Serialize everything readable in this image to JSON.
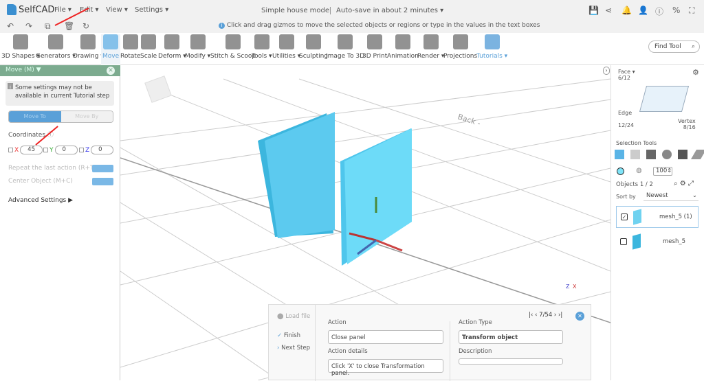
{
  "app": {
    "name": "SelfCAD",
    "doc_title": "Simple house model",
    "autosave": "Auto-save in about 2 minutes"
  },
  "menu": [
    "File",
    "Edit",
    "View",
    "Settings"
  ],
  "hint": "Click and drag gizmos to move the selected objects or regions or type in the values in the text boxes",
  "tools": [
    {
      "label": "3D Shapes",
      "x": "3D Shapes ▾"
    },
    {
      "label": "Generators ▾"
    },
    {
      "label": "Drawing ▾"
    },
    {
      "label": "Move"
    },
    {
      "label": "Rotate"
    },
    {
      "label": "Scale"
    },
    {
      "label": "Deform ▾"
    },
    {
      "label": "Modify ▾"
    },
    {
      "label": "Stitch & Scoop"
    },
    {
      "label": "Tools ▾"
    },
    {
      "label": "Utilities ▾"
    },
    {
      "label": "Sculpting"
    },
    {
      "label": "Image To 3D"
    },
    {
      "label": "3D Print"
    },
    {
      "label": "Animation"
    },
    {
      "label": "Render ▾"
    },
    {
      "label": "Projections"
    },
    {
      "label": "Tutorials ▾"
    }
  ],
  "find_tool": "Find Tool",
  "move_panel": {
    "title": "Move (M) ▼",
    "note": "Some settings may not be available in current Tutorial step",
    "move_to": "Move To",
    "move_by": "Move By",
    "coordinates": "Coordinates",
    "x_label": "X",
    "x": "45",
    "y_label": "Y",
    "y": "0",
    "z_label": "Z",
    "z": "0",
    "repeat": "Repeat the last action (R+T)",
    "center": "Center Object (M+C)",
    "advanced": "Advanced Settings"
  },
  "right": {
    "face": "Face",
    "face_count": "6/12",
    "edge": "Edge",
    "edge_count": "12/24",
    "vertex": "Vertex",
    "vertex_count": "8/16",
    "selection_tools": "Selection Tools",
    "opacity": "100",
    "objects": "Objects 1 / 2",
    "sort_by": "Sort by",
    "sort_value": "Newest",
    "items": [
      {
        "name": "mesh_5 (1)",
        "checked": true
      },
      {
        "name": "mesh_5",
        "checked": false
      }
    ]
  },
  "tutorial": {
    "load_file": "Load file",
    "finish": "Finish",
    "next_step": "Next Step",
    "step": "7/54",
    "action_label": "Action",
    "action": "Close panel",
    "details_label": "Action details",
    "details": "Click 'X' to close Transformation panel.",
    "type_label": "Action Type",
    "type": "Transform object",
    "desc_label": "Description",
    "desc": ""
  },
  "colors": {
    "accent": "#5aa0d8",
    "panel_header": "#7cab8f",
    "object": "#5fcdf0"
  }
}
